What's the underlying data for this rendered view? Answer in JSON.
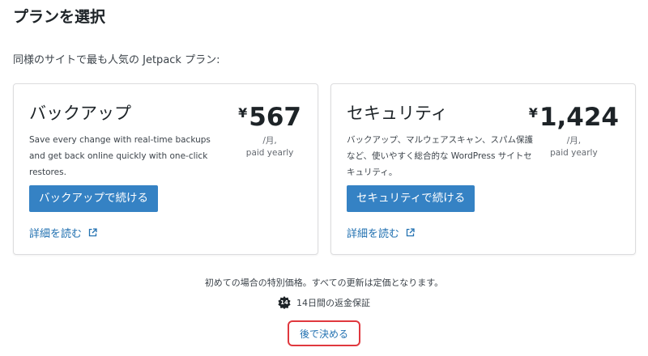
{
  "page": {
    "title": "プランを選択",
    "subtitle": "同様のサイトで最も人気の Jetpack プラン:"
  },
  "plans": [
    {
      "name": "バックアップ",
      "description": "Save every change with real-time backups and get back online quickly with one-click restores.",
      "currency": "¥",
      "price": "567",
      "period": "/月,",
      "billing": "paid yearly",
      "cta_label": "バックアップで続ける",
      "learn_more_label": "詳細を読む"
    },
    {
      "name": "セキュリティ",
      "description": "バックアップ、マルウェアスキャン、スパム保護など、使いやすく総合的な WordPress サイトセキュリティ。",
      "currency": "¥",
      "price": "1,424",
      "period": "/月,",
      "billing": "paid yearly",
      "cta_label": "セキュリティで続ける",
      "learn_more_label": "詳細を読む"
    }
  ],
  "footer": {
    "note": "初めての場合の特別価格。すべての更新は定価となります。",
    "guarantee_badge": "14",
    "guarantee_text": "14日間の返金保証",
    "decide_later_label": "後で決める"
  },
  "colors": {
    "primary_button": "#3582c4",
    "link": "#2271b1",
    "highlight_border": "#e0383e"
  },
  "icons": {
    "external": "external-link-icon",
    "badge": "guarantee-badge-icon"
  }
}
